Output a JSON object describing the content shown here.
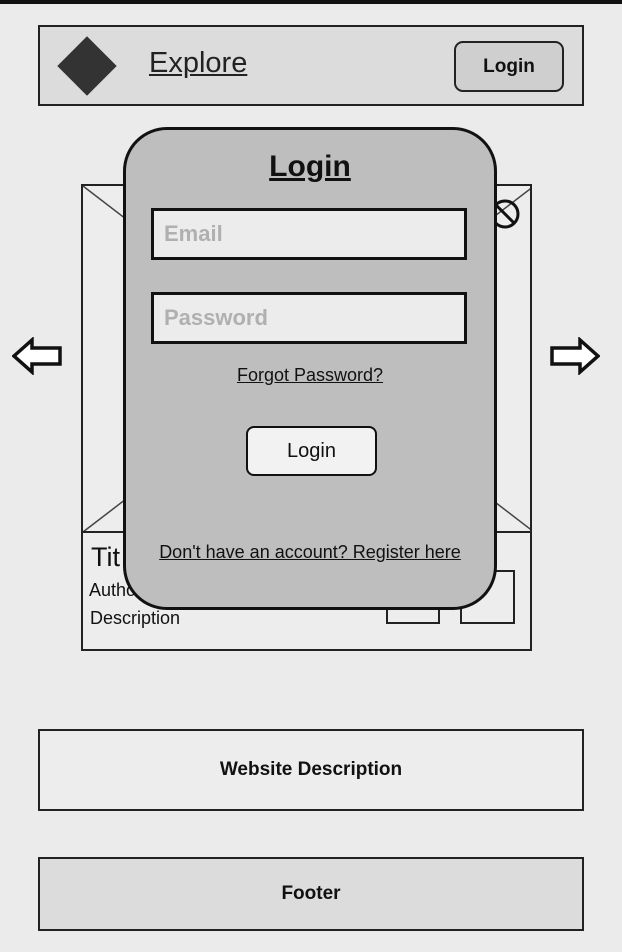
{
  "header": {
    "logo_icon": "diamond-logo",
    "title": "Explore",
    "login_label": "Login"
  },
  "carousel": {
    "prev_icon": "arrow-left-icon",
    "next_icon": "arrow-right-icon",
    "card": {
      "title": "Tit",
      "author": "Autho",
      "description": "Description"
    }
  },
  "login_modal": {
    "title": "Login",
    "email_placeholder": "Email",
    "password_placeholder": "Password",
    "forgot_label": "Forgot Password?",
    "login_label": "Login",
    "register_label": "Don't have an account? Register here"
  },
  "website_description": "Website Description",
  "footer": "Footer"
}
